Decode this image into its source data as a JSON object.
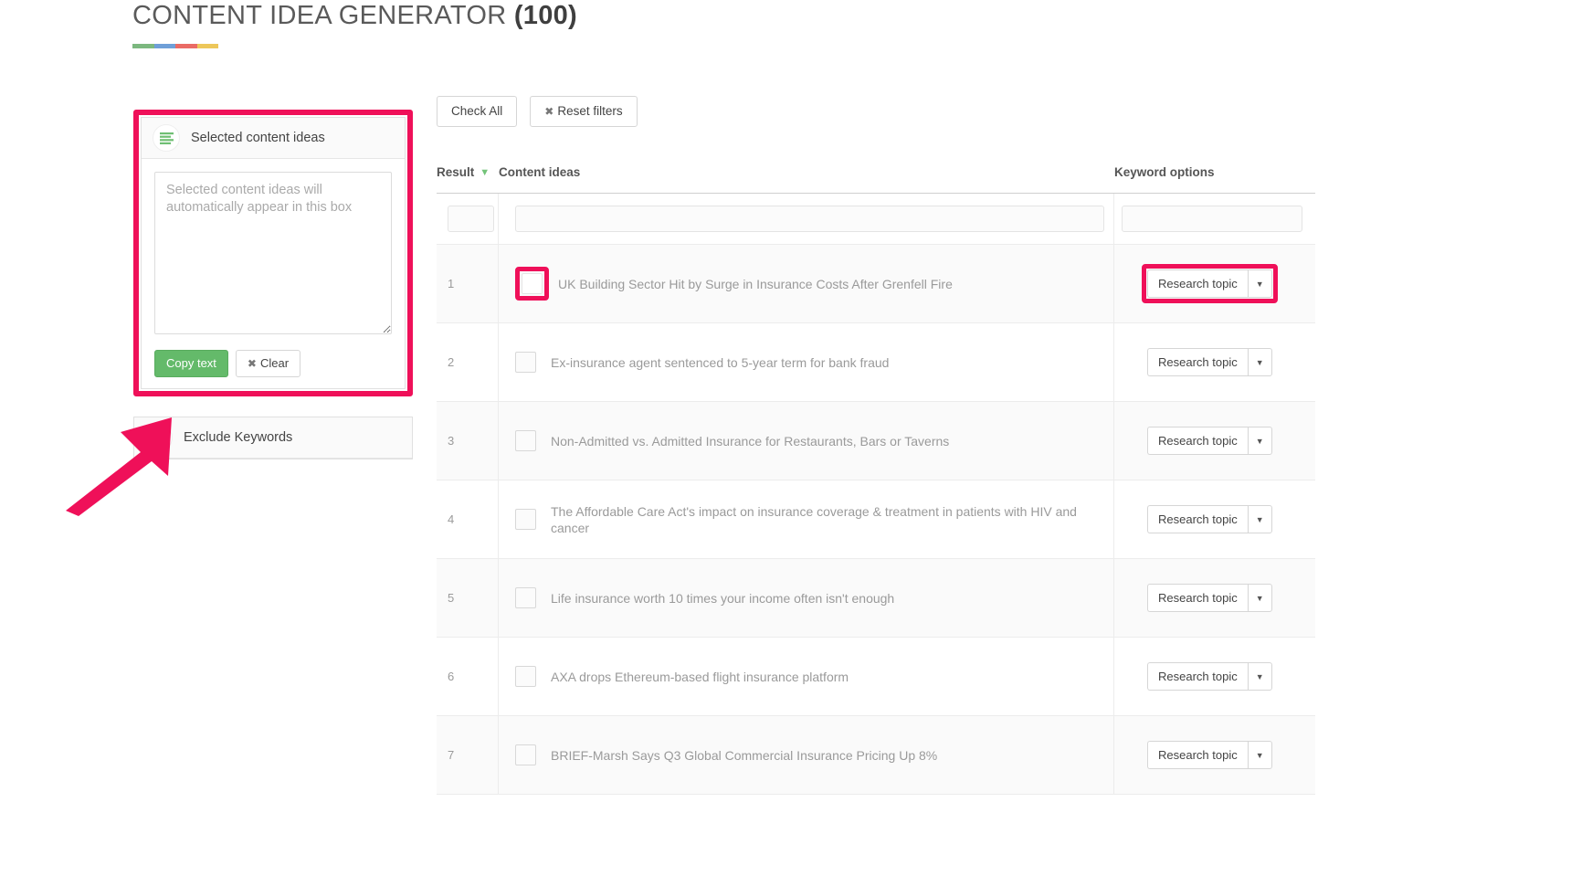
{
  "header": {
    "title": "CONTENT IDEA GENERATOR",
    "count": "(100)",
    "rule_colors": [
      "#7cb87f",
      "#6f9fd8",
      "#ea6b65",
      "#edc75a"
    ]
  },
  "sidebar": {
    "selected_panel": {
      "icon": "list-lines-icon",
      "title": "Selected content ideas",
      "textarea_placeholder": "Selected content ideas will automatically appear in this box",
      "textarea_value": "",
      "copy_button": "Copy text",
      "clear_button": "Clear",
      "clear_icon": "✖"
    },
    "exclude_panel": {
      "icon": "funnel-icon",
      "title": "Exclude Keywords"
    }
  },
  "toolbar": {
    "check_all": "Check All",
    "reset_filters": "Reset filters",
    "reset_icon": "✖"
  },
  "table": {
    "columns": {
      "result": "Result",
      "sort_caret": "▼",
      "content_ideas": "Content ideas",
      "keyword_options": "Keyword options"
    },
    "filters": {
      "result_value": "",
      "content_value": "",
      "keyword_value": ""
    },
    "keyword_button_label": "Research topic",
    "caret_glyph": "▼",
    "rows": [
      {
        "num": "1",
        "idea": "UK Building Sector Hit by Surge in Insurance Costs After Grenfell Fire",
        "checked": false
      },
      {
        "num": "2",
        "idea": "Ex-insurance agent sentenced to 5-year term for bank fraud",
        "checked": false
      },
      {
        "num": "3",
        "idea": "Non-Admitted vs. Admitted Insurance for Restaurants, Bars or Taverns",
        "checked": false
      },
      {
        "num": "4",
        "idea": "The Affordable Care Act's impact on insurance coverage & treatment in patients with HIV and cancer",
        "checked": false
      },
      {
        "num": "5",
        "idea": "Life insurance worth 10 times your income often isn't enough",
        "checked": false
      },
      {
        "num": "6",
        "idea": "AXA drops Ethereum-based flight insurance platform",
        "checked": false
      },
      {
        "num": "7",
        "idea": "BRIEF-Marsh Says Q3 Global Commercial Insurance Pricing Up 8%",
        "checked": false
      }
    ]
  },
  "annotations": {
    "highlight_color": "#ef1059",
    "arrow_target": "exclude-keywords-panel"
  }
}
